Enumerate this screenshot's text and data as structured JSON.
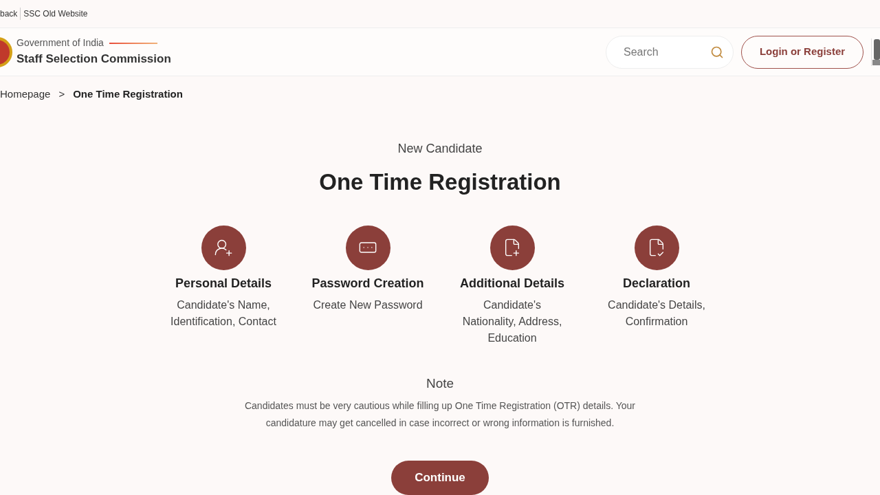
{
  "top_links": [
    "back",
    "SSC Old Website"
  ],
  "header": {
    "subtitle": "Government of India",
    "title": "Staff Selection Commission",
    "search": {
      "placeholder": "Search"
    },
    "login_button": "Login or Register"
  },
  "breadcrumb": [
    "Homepage",
    ">",
    "One Time Registration"
  ],
  "eyebrow": "New Candidate",
  "heading": "One Time Registration",
  "steps": [
    {
      "title": "Personal Details",
      "description": "Candidate's Name,\nIdentification, Contact"
    },
    {
      "title": "Password Creation",
      "description": "Create New Password"
    },
    {
      "title": "Additional Details",
      "description": "Candidate's\nNationality, Address,\nEducation"
    },
    {
      "title": "Declaration",
      "description": "Candidate's Details,\nConfirmation"
    }
  ],
  "note": {
    "title": "Note",
    "text": "Candidates must be very cautious while filling up One Time Registration (OTR) details. Your candidature may get cancelled in case incorrect or wrong information is furnished."
  },
  "continue_button": "Continue"
}
